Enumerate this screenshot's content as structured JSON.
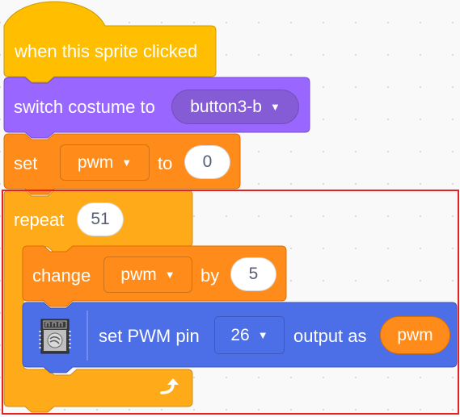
{
  "blocks": {
    "hat": {
      "label": "when this sprite clicked"
    },
    "switch_costume": {
      "label": "switch costume to",
      "costume": "button3-b"
    },
    "set_var": {
      "label_set": "set",
      "variable": "pwm",
      "label_to": "to",
      "value": "0"
    },
    "repeat": {
      "label": "repeat",
      "times": "51"
    },
    "change_var": {
      "label_change": "change",
      "variable": "pwm",
      "label_by": "by",
      "value": "5"
    },
    "set_pwm": {
      "label_pin": "set PWM pin",
      "pin": "26",
      "label_output": "output as",
      "value": "pwm"
    }
  },
  "highlight_color": "#e8211f",
  "icons": {
    "loop_arrow": "loop-arrow-icon",
    "board": "esp32-board-icon",
    "dropdown": "chevron-down-icon"
  }
}
